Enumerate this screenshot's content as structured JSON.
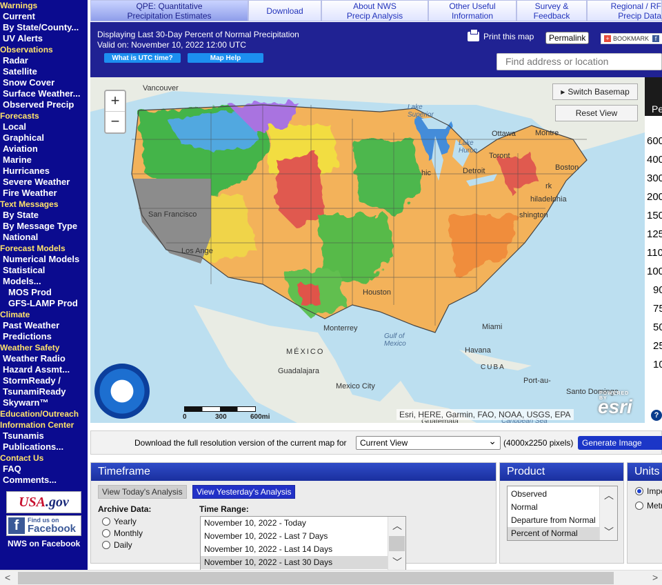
{
  "leftnav": {
    "sections": [
      {
        "header": "Warnings",
        "items": [
          {
            "label": "Current"
          },
          {
            "label": "By State/County..."
          },
          {
            "label": "UV Alerts"
          }
        ]
      },
      {
        "header": "Observations",
        "items": [
          {
            "label": "Radar"
          },
          {
            "label": "Satellite"
          },
          {
            "label": "Snow Cover"
          },
          {
            "label": "Surface Weather..."
          },
          {
            "label": "Observed Precip"
          }
        ]
      },
      {
        "header": "Forecasts",
        "items": [
          {
            "label": "Local"
          },
          {
            "label": "Graphical"
          },
          {
            "label": "Aviation"
          },
          {
            "label": "Marine"
          },
          {
            "label": "Hurricanes"
          },
          {
            "label": "Severe Weather"
          },
          {
            "label": "Fire Weather"
          }
        ]
      },
      {
        "header": "Text Messages",
        "items": [
          {
            "label": "By State"
          },
          {
            "label": "By Message Type"
          },
          {
            "label": "National"
          }
        ]
      },
      {
        "header": "Forecast Models",
        "items": [
          {
            "label": "Numerical Models"
          },
          {
            "label": "Statistical"
          },
          {
            "label": "Models..."
          },
          {
            "label": "MOS Prod",
            "sub": true
          },
          {
            "label": "GFS-LAMP Prod",
            "sub": true
          }
        ]
      },
      {
        "header": "Climate",
        "items": [
          {
            "label": "Past Weather"
          },
          {
            "label": "Predictions"
          }
        ]
      },
      {
        "header": "Weather Safety",
        "items": [
          {
            "label": "Weather Radio"
          },
          {
            "label": "Hazard Assmt..."
          },
          {
            "label": "StormReady /"
          },
          {
            "label": "TsunamiReady"
          },
          {
            "label": "Skywarn™"
          }
        ]
      },
      {
        "header": "Education/Outreach",
        "items": []
      },
      {
        "header": "Information Center",
        "items": [
          {
            "label": "Tsunamis"
          },
          {
            "label": "Publications..."
          }
        ]
      },
      {
        "header": "Contact Us",
        "items": [
          {
            "label": "FAQ"
          },
          {
            "label": "Comments..."
          }
        ]
      }
    ],
    "usagov": {
      "a": "USA",
      "b": ".gov"
    },
    "facebook": {
      "line1": "Find us on",
      "line2": "Facebook"
    },
    "nws_facebook": "NWS on Facebook"
  },
  "tabs": [
    {
      "l1": "QPE: Quantitative",
      "l2": "Precipitation Estimates"
    },
    {
      "l1": "Download",
      "l2": ""
    },
    {
      "l1": "About NWS",
      "l2": "Precip Analysis"
    },
    {
      "l1": "Other Useful",
      "l2": "Information"
    },
    {
      "l1": "Survey &",
      "l2": "Feedback"
    },
    {
      "l1": "Regional / RF",
      "l2": "Precip Data"
    }
  ],
  "info": {
    "displaying": "Displaying Last 30-Day Percent of Normal Precipitation",
    "valid": "Valid on: November 10, 2022 12:00 UTC",
    "utc_btn": "What is UTC time?",
    "help_btn": "Map Help",
    "print": "Print this map",
    "permalink": "Permalink",
    "bookmark": "BOOKMARK",
    "search_placeholder": "Find address or location"
  },
  "map": {
    "switch_basemap": "Switch Basemap",
    "reset_view": "Reset View",
    "zoom_in": "+",
    "zoom_out": "−",
    "noaa": "NOAA",
    "scale": {
      "s0": "0",
      "s1": "300",
      "s2": "600mi"
    },
    "attribution": "Esri, HERE, Garmin, FAO, NOAA, USGS, EPA",
    "esri": "esri",
    "powered": "POWERED BY",
    "labels": {
      "vancouver": "Vancouver",
      "lake_superior": "Lake Superior",
      "ottawa": "Ottawa",
      "montreal": "Montre",
      "lake_huron": "Lake Huron",
      "toronto": "Toront",
      "boston": "Boston",
      "chicago": "hic",
      "detroit": "Detroit",
      "newyork": "rk",
      "philadelphia": "hiladelphia",
      "washington": "shington",
      "sanfrancisco": "San Francisco",
      "losangeles": "Los Ange",
      "houston": "Houston",
      "monterrey": "Monterrey",
      "gulf": "Gulf of Mexico",
      "miami": "Miami",
      "mexico": "MÉXICO",
      "havana": "Havana",
      "cuba": "CUBA",
      "guadalajara": "Guadalajara",
      "mexicocity": "Mexico City",
      "portau": "Port-au-",
      "santodomingo": "Santo Domingo",
      "guatemala": "Guatemala",
      "caribbean": "Caribbean Sea"
    }
  },
  "legend": {
    "head": "Pe",
    "values": [
      "600",
      "400",
      "300",
      "200",
      "150",
      "125",
      "110",
      "100",
      "90",
      "75",
      "50",
      "25",
      "10"
    ],
    "help": "?"
  },
  "download": {
    "label": "Download the full resolution version of the current map for",
    "selected": "Current View",
    "pixels": "(4000x2250 pixels)",
    "generate": "Generate Image"
  },
  "timeframe": {
    "title": "Timeframe",
    "today_btn": "View Today's Analysis",
    "yesterday_btn": "View Yesterday's Analysis",
    "archive_label": "Archive Data:",
    "archive_options": [
      {
        "label": "Yearly"
      },
      {
        "label": "Monthly"
      },
      {
        "label": "Daily"
      }
    ],
    "range_label": "Time Range:",
    "ranges": [
      {
        "label": "November 10, 2022 - Today"
      },
      {
        "label": "November 10, 2022 - Last 7 Days"
      },
      {
        "label": "November 10, 2022 - Last 14 Days"
      },
      {
        "label": "November 10, 2022 - Last 30 Days"
      }
    ]
  },
  "product": {
    "title": "Product",
    "options": [
      {
        "label": "Observed"
      },
      {
        "label": "Normal"
      },
      {
        "label": "Departure from Normal"
      },
      {
        "label": "Percent of Normal"
      }
    ]
  },
  "units": {
    "title": "Units",
    "options": [
      {
        "label": "Impe"
      },
      {
        "label": "Metr"
      }
    ]
  }
}
